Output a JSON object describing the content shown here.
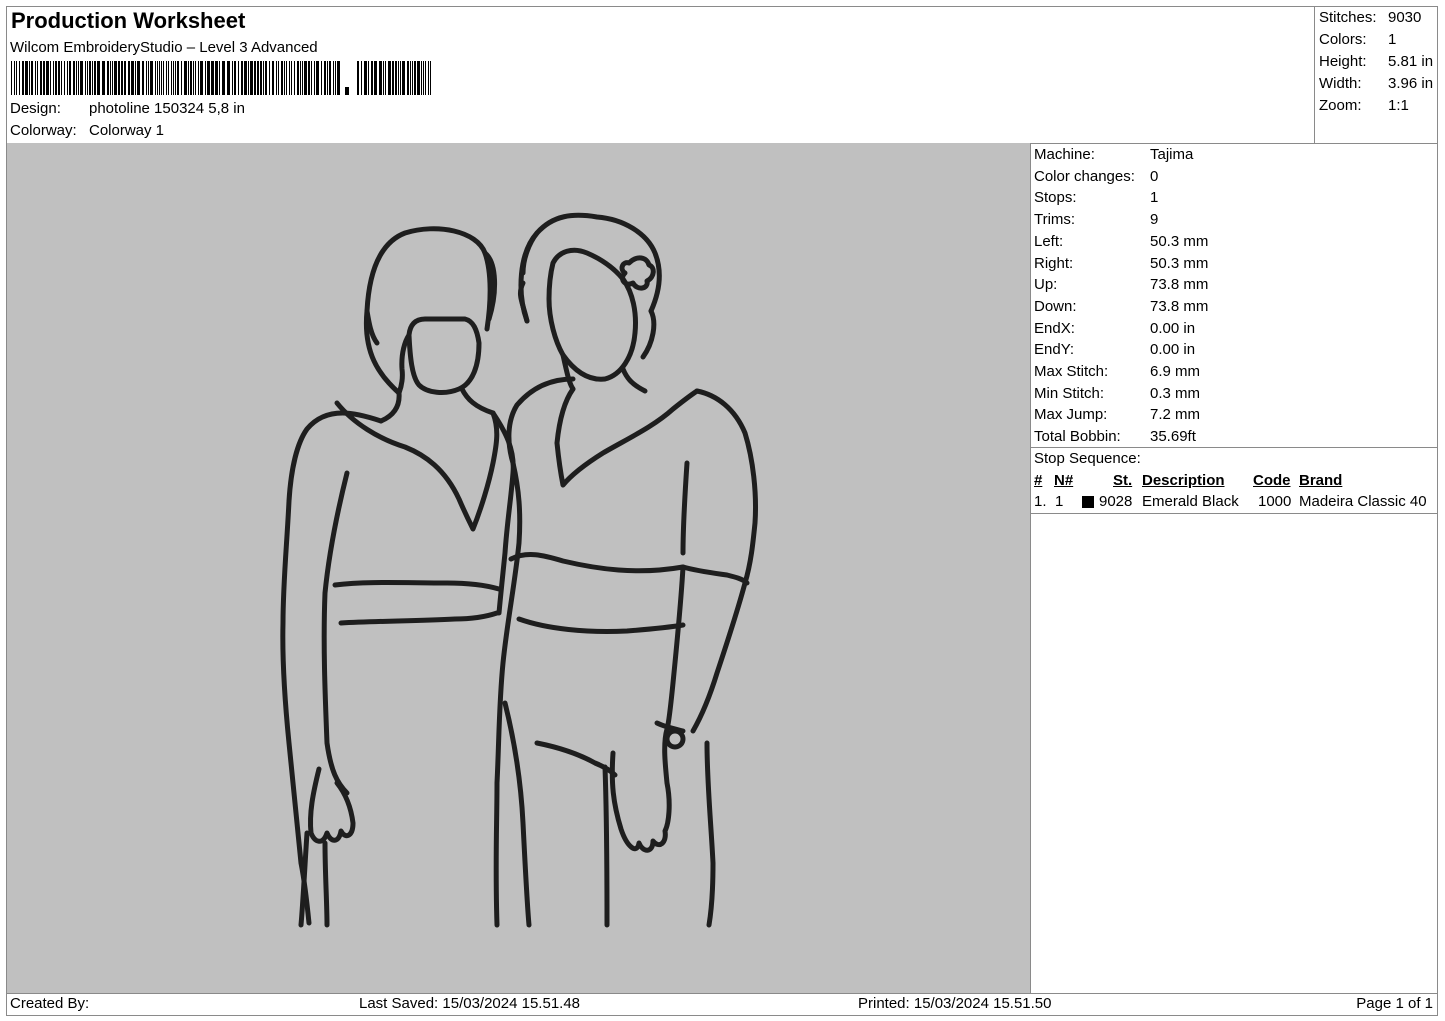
{
  "header": {
    "title": "Production Worksheet",
    "software": "Wilcom EmbroideryStudio – Level 3 Advanced",
    "barcode_icon": "barcode-icon",
    "design_label": "Design:",
    "design_value": "photoline 150324 5,8 in",
    "colorway_label": "Colorway:",
    "colorway_value": "Colorway 1"
  },
  "summary": [
    {
      "label": "Stitches:",
      "value": "9030"
    },
    {
      "label": "Colors:",
      "value": "1"
    },
    {
      "label": "Height:",
      "value": "5.81 in"
    },
    {
      "label": "Width:",
      "value": "3.96 in"
    },
    {
      "label": "Zoom:",
      "value": "1:1"
    }
  ],
  "machine_info": [
    {
      "label": "Machine:",
      "value": "Tajima"
    },
    {
      "label": "Color changes:",
      "value": "0"
    },
    {
      "label": "Stops:",
      "value": "1"
    },
    {
      "label": "Trims:",
      "value": "9"
    },
    {
      "label": "Left:",
      "value": "50.3 mm"
    },
    {
      "label": "Right:",
      "value": "50.3 mm"
    },
    {
      "label": "Up:",
      "value": "73.8 mm"
    },
    {
      "label": "Down:",
      "value": "73.8 mm"
    },
    {
      "label": "EndX:",
      "value": "0.00 in"
    },
    {
      "label": "EndY:",
      "value": "0.00 in"
    },
    {
      "label": "Max Stitch:",
      "value": "6.9 mm"
    },
    {
      "label": "Min Stitch:",
      "value": "0.3 mm"
    },
    {
      "label": "Max Jump:",
      "value": "7.2 mm"
    },
    {
      "label": "Total Bobbin:",
      "value": "35.69ft"
    }
  ],
  "stop_sequence": {
    "title": "Stop Sequence:",
    "headers": [
      "#",
      "N#",
      "St.",
      "Description",
      "Code",
      "Brand"
    ],
    "rows": [
      {
        "num": "1.",
        "n": "1",
        "swatch_color": "#000000",
        "st": "9028",
        "description": "Emerald Black",
        "code": "1000",
        "brand": "Madeira Classic 40"
      }
    ]
  },
  "preview": {
    "background_color": "#c0c0c0",
    "thread_color": "#1e1e1e",
    "subject_icon": "two-women-line-art-embroidery"
  },
  "footer": {
    "created_by": "Created By:",
    "last_saved": "Last Saved: 15/03/2024 15.51.48",
    "printed": "Printed: 15/03/2024 15.51.50",
    "page": "Page 1 of 1"
  }
}
